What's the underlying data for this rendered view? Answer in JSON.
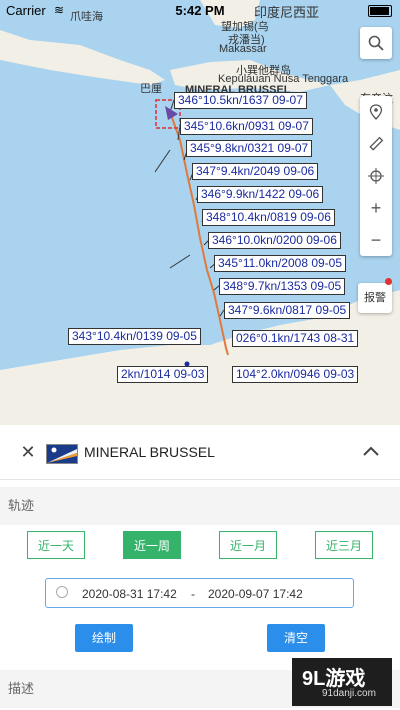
{
  "status_bar": {
    "carrier": "Carrier",
    "time": "5:42 PM"
  },
  "map": {
    "place_labels": {
      "city_top": "爪哇海",
      "top_right_region": "印度尼西亚",
      "makassar_cn": "望加锡(乌",
      "makassar_cn2": "戎潘当)",
      "makassar": "Makassar",
      "sunda_cn": "小巽他群岛",
      "sunda": "Kepulauan Nusa Tenggara",
      "east_timor": "东帝汶",
      "bali": "巴厘"
    },
    "ship_label": "MINERAL BRUSSEL",
    "track_labels": [
      "346°10.5kn/1637 09-07",
      "345°10.6kn/0931 09-07",
      "345°9.8kn/0321 09-07",
      "347°9.4kn/2049 09-06",
      "346°9.9kn/1422 09-06",
      "348°10.4kn/0819 09-06",
      "346°10.0kn/0200 09-06",
      "345°11.0kn/2008 09-05",
      "348°9.7kn/1353 09-05",
      "347°9.6kn/0817 09-05",
      "343°10.4kn/0139 09-05",
      "026°0.1kn/1743 08-31",
      "2kn/1014 09-03",
      "104°2.0kn/0946 09-03"
    ],
    "controls": {
      "search_icon": "search-icon",
      "alert_label": "报警"
    }
  },
  "panel": {
    "ship_name": "MINERAL BRUSSEL",
    "track_section": "轨迹",
    "ranges": [
      "近一天",
      "近一周",
      "近一月",
      "近三月"
    ],
    "active_range": "近一周",
    "date_start": "2020-08-31 17:42",
    "date_separator": "-",
    "date_end": "2020-09-07 17:42",
    "draw_button": "绘制",
    "clear_button": "清空",
    "description_section": "描述"
  },
  "watermark": {
    "brand": "9L游戏",
    "site": "91danji.com"
  },
  "colors": {
    "accent_green": "#35b36b",
    "accent_blue": "#2a8eea",
    "sea": "#a9d3ef",
    "land": "#f2efe6",
    "track": "#e07a3a"
  }
}
